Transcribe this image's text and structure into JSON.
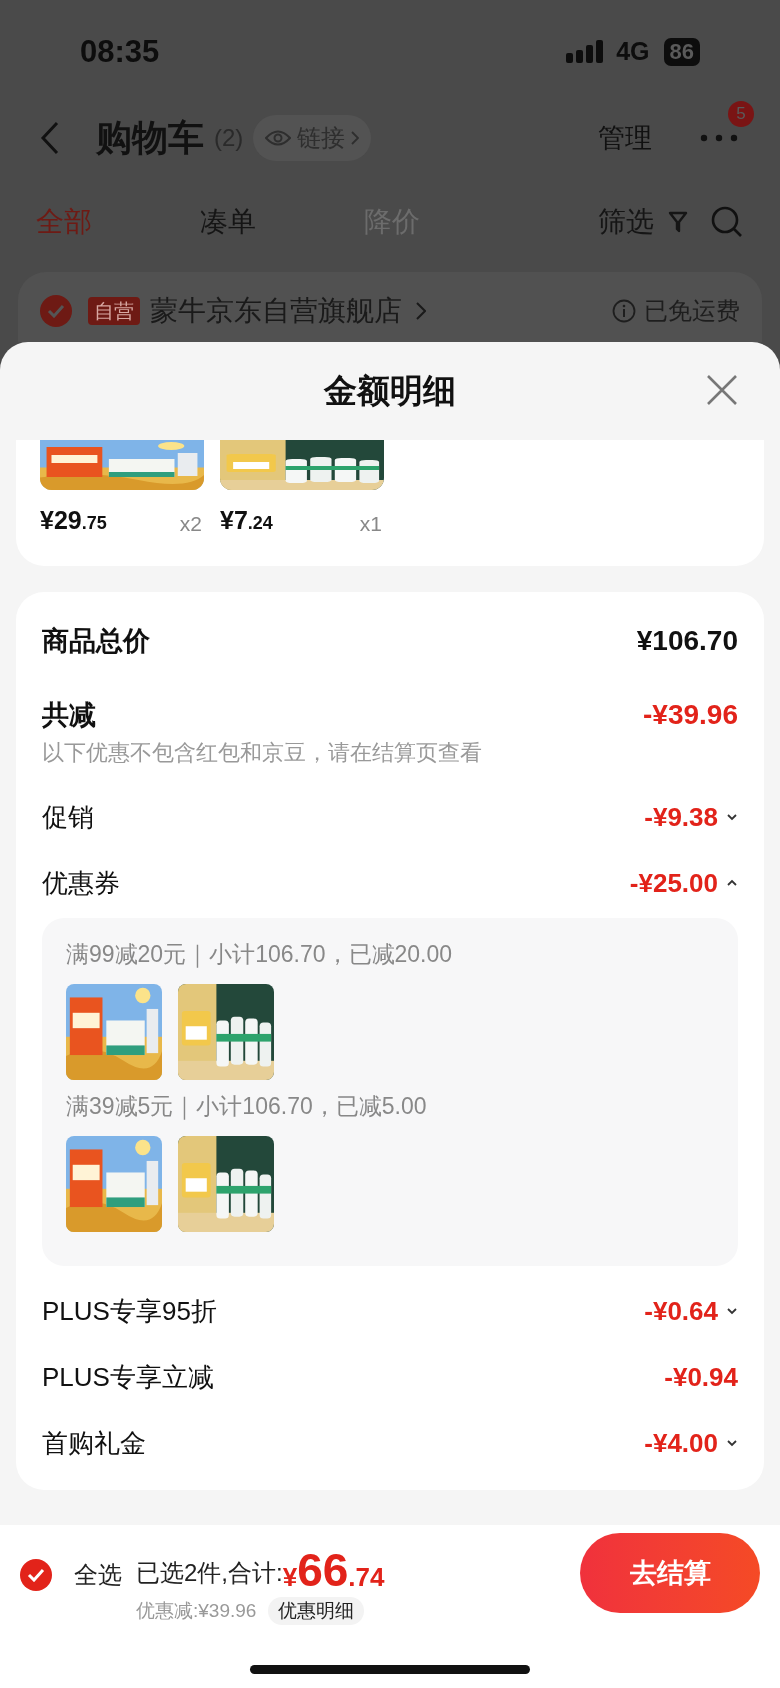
{
  "status_bar": {
    "time": "08:35",
    "network": "4G",
    "battery": "86"
  },
  "nav": {
    "title": "购物车",
    "count": "(2)",
    "link": "链接",
    "manage": "管理",
    "more_badge": "5"
  },
  "tabs": [
    {
      "label": "全部",
      "selected": true,
      "disabled": false,
      "kind": "text"
    },
    {
      "label": "凑单",
      "selected": false,
      "disabled": false,
      "kind": "text"
    },
    {
      "label": "降价",
      "selected": false,
      "disabled": true,
      "kind": "text"
    },
    {
      "label": "筛选",
      "selected": false,
      "disabled": false,
      "kind": "filter"
    }
  ],
  "store": {
    "checked": true,
    "tag": "自营",
    "name": "蒙牛京东自营旗舰店",
    "shipping": "已免运费"
  },
  "sheet": {
    "title": "金额明细",
    "products": [
      {
        "kind": "picture",
        "price_int": "¥29",
        "price_dec": ".75",
        "qty": "x2"
      },
      {
        "kind": "picture",
        "price_int": "¥7",
        "price_dec": ".24",
        "qty": "x1"
      }
    ],
    "total": {
      "label": "商品总价",
      "amount": "¥106.70"
    },
    "discount": {
      "label": "共减",
      "amount": "-¥39.96",
      "note": "以下优惠不包含红包和京豆，请在结算页查看"
    },
    "rows": [
      {
        "label": "促销",
        "amount": "-¥9.38",
        "expanded": false
      },
      {
        "label": "优惠券",
        "amount": "-¥25.00",
        "expanded": true,
        "coupons": [
          {
            "text": "满99减20元｜小计106.70，已减20.00"
          },
          {
            "text": "满39减5元｜小计106.70，已减5.00"
          }
        ]
      },
      {
        "label": "PLUS专享95折",
        "amount": "-¥0.64",
        "expanded": false
      },
      {
        "label": "PLUS专享立减",
        "amount": "-¥0.94"
      },
      {
        "label": "首购礼金",
        "amount": "-¥4.00",
        "expanded": false
      }
    ]
  },
  "footer": {
    "select_all": {
      "label": "全选",
      "checked": true
    },
    "summary": "已选2件,合计:",
    "currency": "¥",
    "total_int": "66",
    "total_dec": ".74",
    "saved": "优惠减:¥39.96",
    "detail_chip": "优惠明细",
    "checkout": "去结算"
  }
}
